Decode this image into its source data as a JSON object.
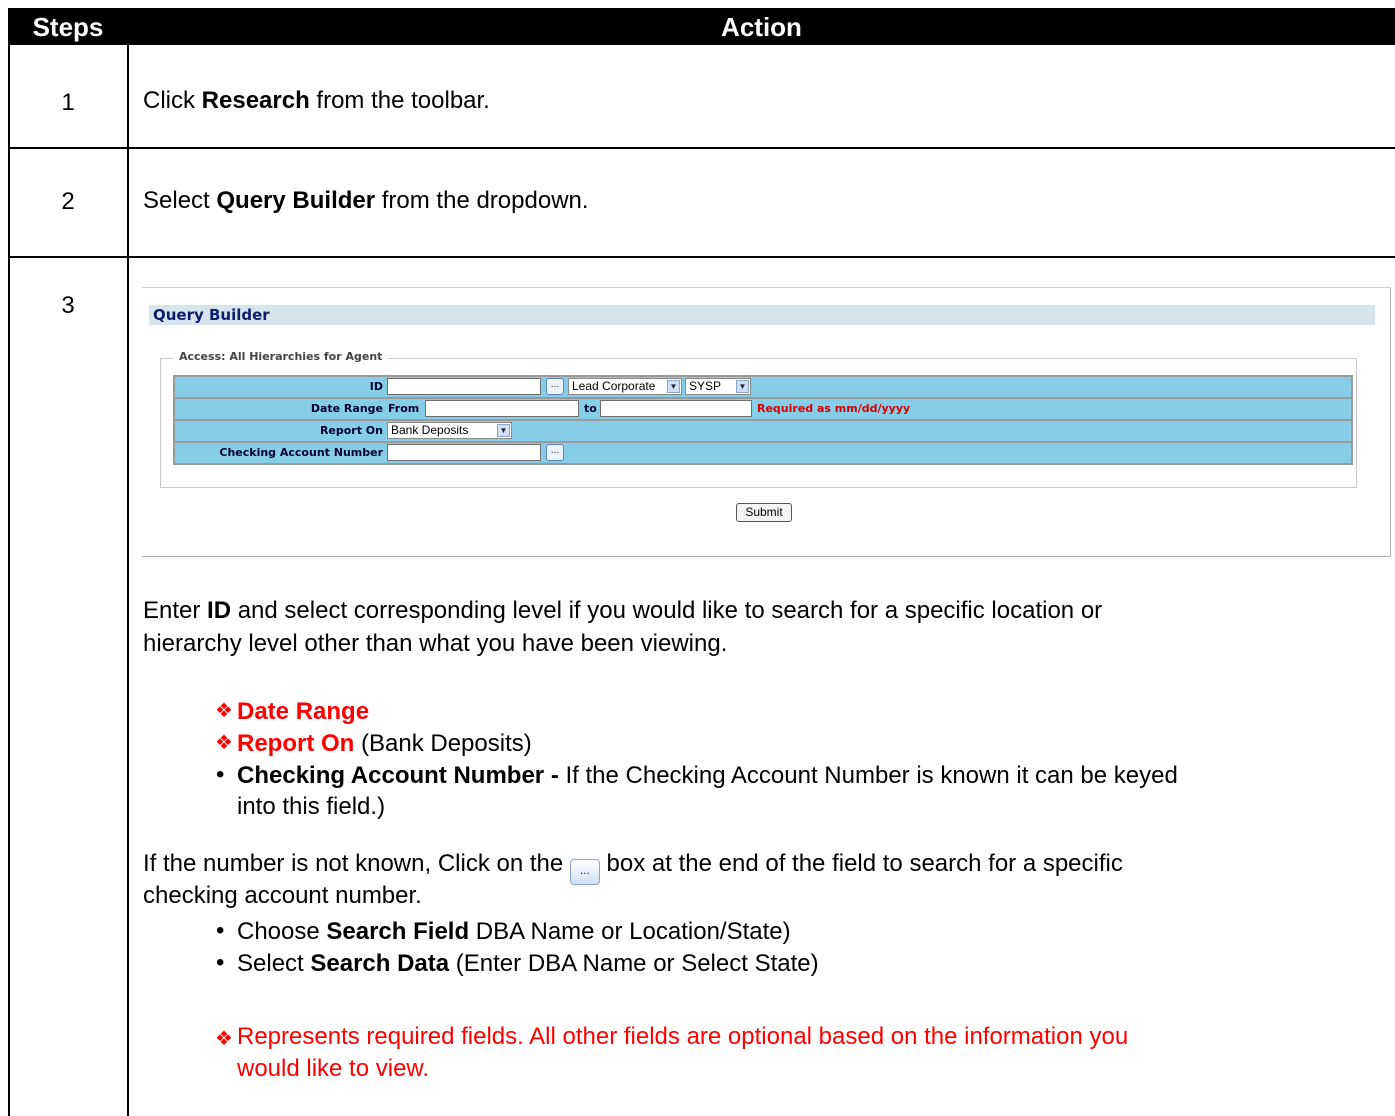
{
  "table": {
    "header_steps": "Steps",
    "header_action": "Action",
    "rows": [
      {
        "step": "1"
      },
      {
        "step": "2"
      },
      {
        "step": "3"
      }
    ]
  },
  "step1": {
    "pre": "Click ",
    "bold": "Research",
    "post": " from the toolbar."
  },
  "step2": {
    "pre": "Select ",
    "bold": "Query Builder",
    "post": " from the dropdown."
  },
  "query_builder": {
    "title": "Query Builder",
    "legend": "Access: All Hierarchies for Agent",
    "id_label": "ID",
    "id_button": "...",
    "level_select": "Lead Corporate",
    "sys_select": "SYSP",
    "date_label": "Date Range",
    "from_label": "From",
    "to_label": "to",
    "date_required": "Required as mm/dd/yyyy",
    "report_label": "Report On",
    "report_select": "Bank Deposits",
    "checking_label": "Checking Account Number",
    "checking_button": "...",
    "submit": "Submit"
  },
  "step3": {
    "p1_pre": "Enter ",
    "p1_bold": "ID",
    "p1_post_line1": " and select corresponding level if you would like to search for a specific location or",
    "p1_line2": "hierarchy level other than what you have been viewing.",
    "bullet_date": "Date Range",
    "bullet_report": "Report On",
    "bullet_report_rest": " (Bank Deposits)",
    "bullet_checking_bold": "Checking Account Number - ",
    "bullet_checking_rest": "If the Checking Account Number is known it can be keyed",
    "bullet_checking_line2": "into this field.)",
    "p2_pre": "If the number is not known, Click on the ",
    "p2_button": "...",
    "p2_post": " box at the end of the field to search for a specific",
    "p2_line2": "checking account number.",
    "choose_pre": "Choose ",
    "choose_bold": "Search Field",
    "choose_rest": " DBA Name or Location/State)",
    "select_pre": "Select ",
    "select_bold": "Search Data",
    "select_rest": " (Enter DBA Name or Select State)",
    "note_line1": "Represents required fields. All other fields are optional based on the information you",
    "note_line2": "would like to view."
  },
  "colors": {
    "header_bg": "#000000",
    "required": "#ff0000",
    "form_row": "#86cde8",
    "form_title_bg": "#d6e4ec"
  },
  "icons": {
    "bullet_required": "diamond-cluster-icon",
    "bullet_regular": "dot-icon"
  }
}
